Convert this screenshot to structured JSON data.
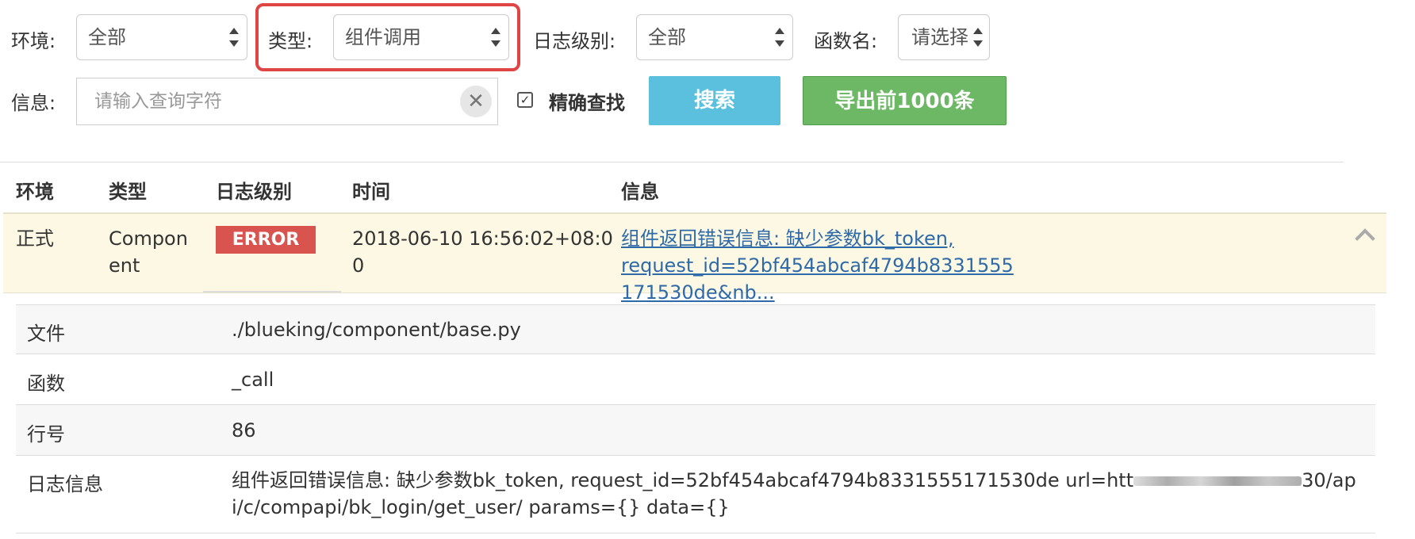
{
  "filters": {
    "env_label": "环境:",
    "env_value": "全部",
    "type_label": "类型:",
    "type_value": "组件调用",
    "level_label": "日志级别:",
    "level_value": "全部",
    "func_label": "函数名:",
    "func_value": "请选择",
    "info_label": "信息:",
    "info_placeholder": "请输入查询字符",
    "exact_label": "精确查找",
    "exact_checked": true,
    "search_button": "搜索",
    "export_button": "导出前1000条"
  },
  "table": {
    "headers": [
      "环境",
      "类型",
      "日志级别",
      "时间",
      "信息"
    ],
    "row": {
      "env": "正式",
      "type_line1": "Compon",
      "type_line2": "ent",
      "level": "ERROR",
      "time_line1": "2018-06-10 16:56:02+08:0",
      "time_line2": "0",
      "message_line1": "组件返回错误信息: 缺少参数bk_token, request_id=52bf454abcaf4794b8331555",
      "message_line2": "171530de&nb..."
    }
  },
  "details": [
    {
      "key": "文件",
      "value": "./blueking/component/base.py"
    },
    {
      "key": "函数",
      "value": "_call"
    },
    {
      "key": "行号",
      "value": "86"
    },
    {
      "key": "日志信息",
      "value_line1_a": "组件返回错误信息: 缺少参数bk_token, request_id=52bf454abcaf4794b8331555171530de url=htt",
      "value_line1_b": "30/ap",
      "value_line2": "i/c/compapi/bk_login/get_user/ params={} data={}"
    }
  ],
  "colors": {
    "search": "#5bc0de",
    "export": "#6cb865",
    "error_badge": "#d9534f",
    "highlight": "#e04545",
    "row_bg": "#fcf8e3",
    "link": "#2f6aa8"
  }
}
